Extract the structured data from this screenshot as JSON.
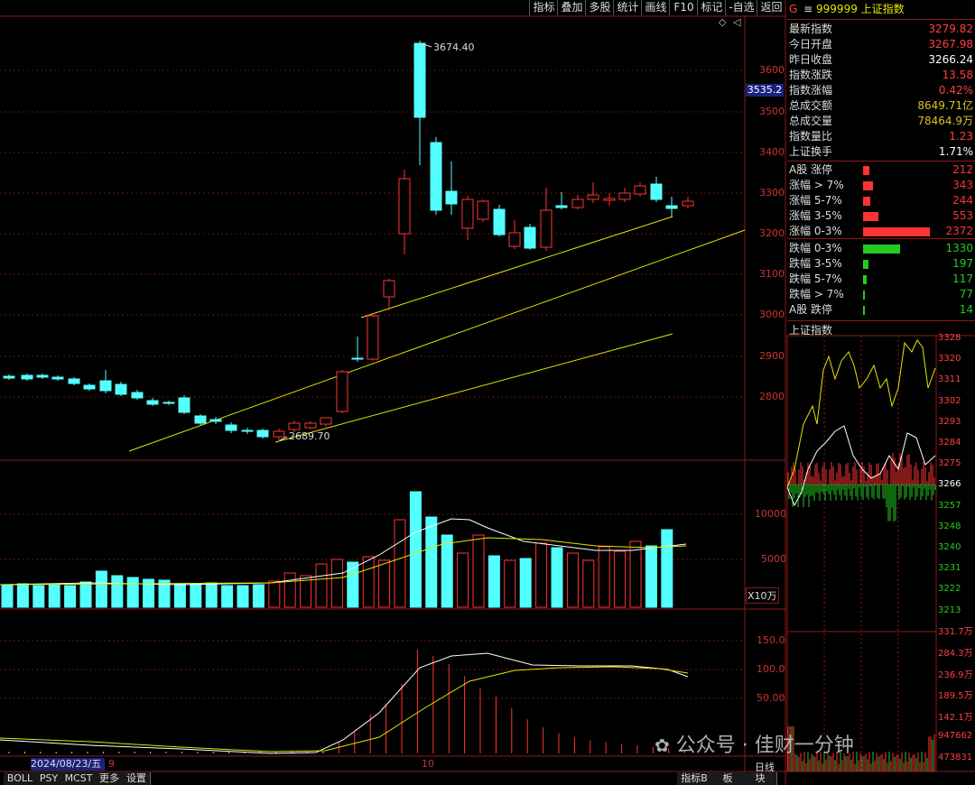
{
  "toolbar": {
    "buttons": [
      "指标",
      "叠加",
      "多股",
      "统计",
      "画线",
      "F10",
      "标记",
      "-自选",
      "返回"
    ]
  },
  "index_header": {
    "g_label": "G",
    "menu_icon": "≡",
    "code": "999999",
    "name": "上证指数"
  },
  "quote_info": [
    {
      "label": "最新指数",
      "value": "3279.82",
      "color": "#ff4040"
    },
    {
      "label": "今日开盘",
      "value": "3267.98",
      "color": "#ff4040"
    },
    {
      "label": "昨日收盘",
      "value": "3266.24",
      "color": "#ffffff"
    },
    {
      "label": "指数涨跌",
      "value": "13.58",
      "color": "#ff4040"
    },
    {
      "label": "指数涨幅",
      "value": "0.42%",
      "color": "#ff4040"
    },
    {
      "label": "总成交额",
      "value": "8649.71亿",
      "color": "#d8c020"
    },
    {
      "label": "总成交量",
      "value": "78464.9万",
      "color": "#d8c020"
    },
    {
      "label": "指数量比",
      "value": "1.23",
      "color": "#ff4040"
    },
    {
      "label": "上证换手",
      "value": "1.71%",
      "color": "#ffffff"
    }
  ],
  "distribution": {
    "up": [
      {
        "label": "A股 涨停",
        "value": "212",
        "count": 212
      },
      {
        "label": "涨幅 > 7%",
        "value": "343",
        "count": 343
      },
      {
        "label": "涨幅 5-7%",
        "value": "244",
        "count": 244
      },
      {
        "label": "涨幅 3-5%",
        "value": "553",
        "count": 553
      },
      {
        "label": "涨幅 0-3%",
        "value": "2372",
        "count": 2372
      }
    ],
    "down": [
      {
        "label": "跌幅 0-3%",
        "value": "1330",
        "count": 1330
      },
      {
        "label": "跌幅 3-5%",
        "value": "197",
        "count": 197
      },
      {
        "label": "跌幅 5-7%",
        "value": "117",
        "count": 117
      },
      {
        "label": "跌幅 > 7%",
        "value": "77",
        "count": 77
      },
      {
        "label": "A股 跌停",
        "value": "14",
        "count": 14
      }
    ],
    "up_color": "#ff3333",
    "down_color": "#22cc22"
  },
  "intraday": {
    "title": "上证指数",
    "price_labels": [
      "3328",
      "3320",
      "3311",
      "3302",
      "3293",
      "3284",
      "3275",
      "3266",
      "3257",
      "3248",
      "3240",
      "3231",
      "3222",
      "3213"
    ],
    "volume_labels": [
      "331.7万",
      "284.3万",
      "236.9万",
      "189.5万",
      "142.1万",
      "947662",
      "473831"
    ]
  },
  "kline": {
    "price_axis": [
      "3600",
      "3500",
      "3400",
      "3300",
      "3200",
      "3100",
      "3000",
      "2900",
      "2800"
    ],
    "current_price_tag": "3535.2",
    "high_annotation": "3674.40",
    "low_annotation": "2689.70",
    "volume_axis": [
      "10000",
      "5000"
    ],
    "volume_unit": "X10万",
    "macd_axis": [
      "150.0",
      "100.0",
      "50.00"
    ],
    "date_tag": "2024/08/23/五",
    "month_labels": [
      "9",
      "10"
    ],
    "period_label": "日线"
  },
  "bottom_tabs": [
    "BOLL",
    "PSY",
    "MCST",
    "更多",
    "设置"
  ],
  "bottom_right_tabs": [
    "指标B",
    "板",
    "块"
  ],
  "watermark": {
    "text": "公众号 · 佳财一分钟"
  },
  "colors": {
    "up": "#ff3333",
    "down": "#54ffff",
    "ma": "#e6e600",
    "grid": "#8b1a1a"
  }
}
